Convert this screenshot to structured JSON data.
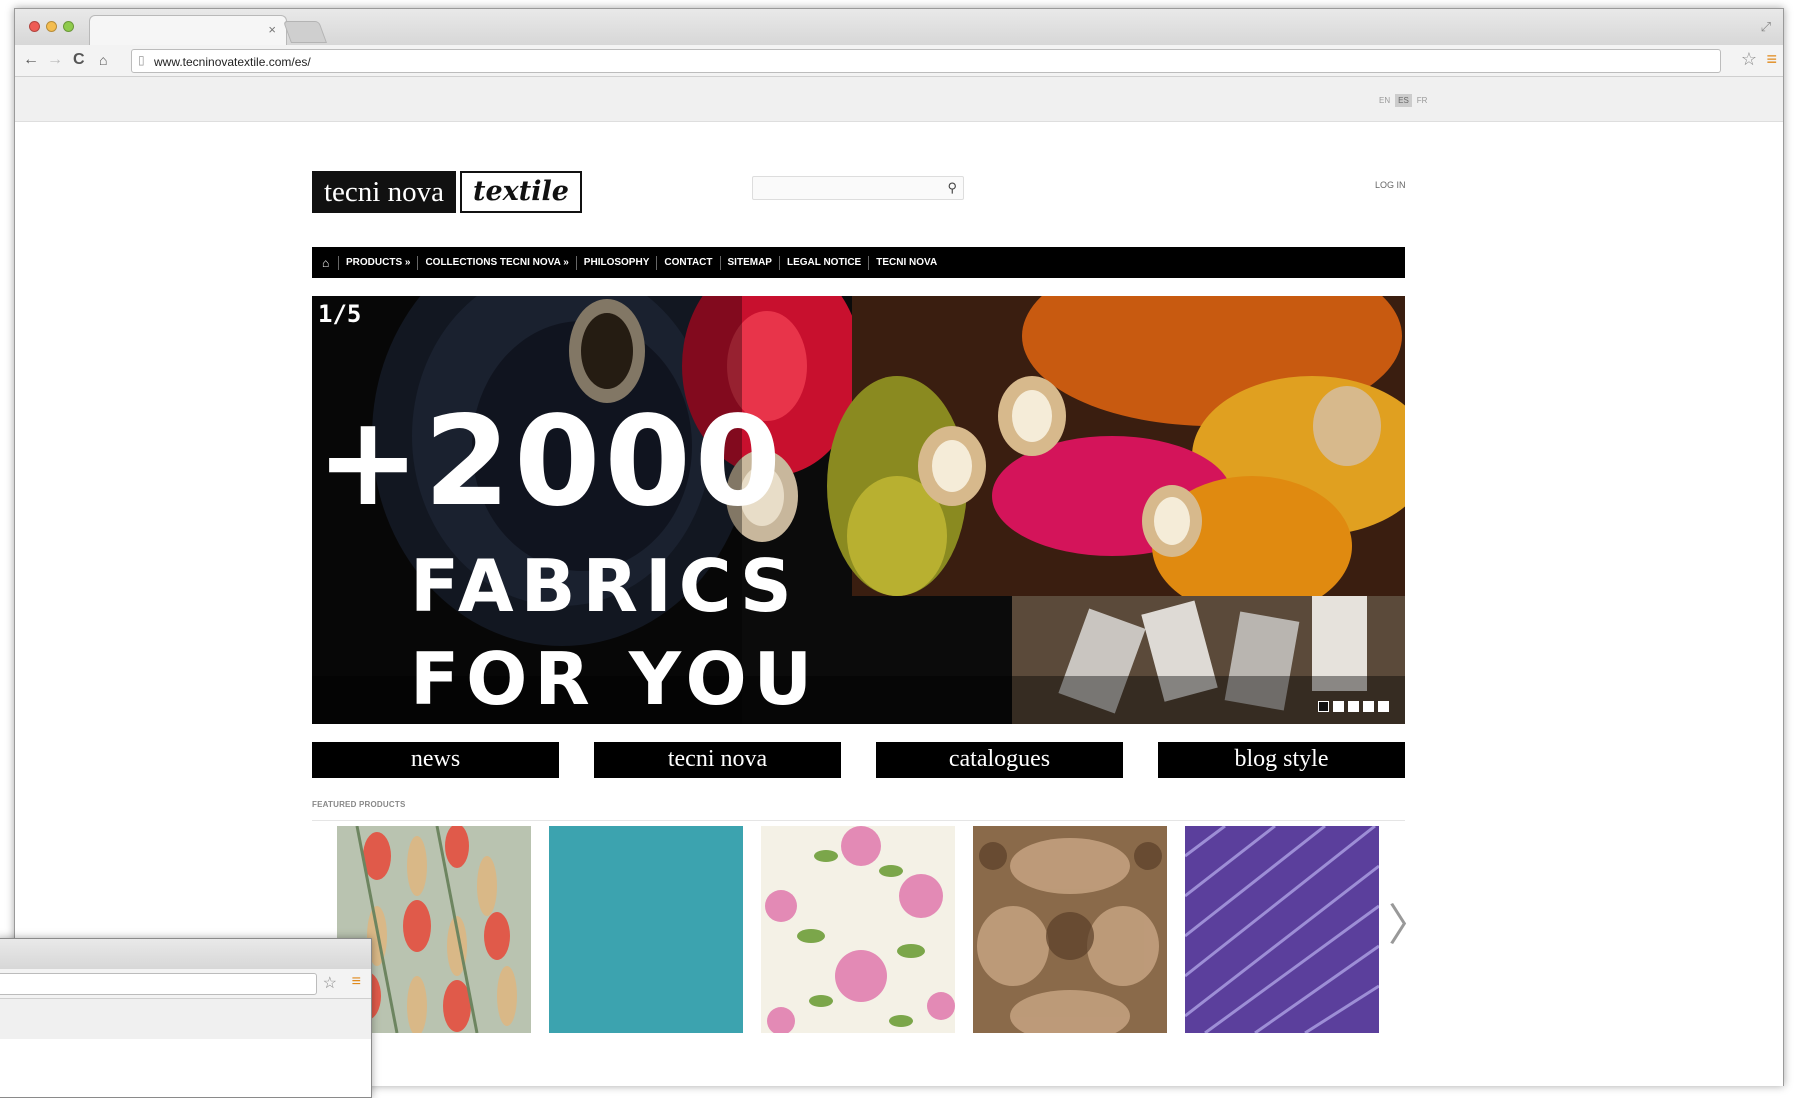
{
  "browser": {
    "url": "www.tecninovatextile.com/es/",
    "tab_close": "×",
    "resize_glyph": "⤢",
    "icons": [
      "back-arrow-icon",
      "forward-arrow-icon",
      "reload-icon",
      "home-icon",
      "star-icon",
      "menu-icon",
      "search-icon"
    ]
  },
  "languages": [
    "EN",
    "ES",
    "FR"
  ],
  "header": {
    "logo_left": "tecni nova",
    "logo_right": "textile",
    "login": "LOG IN"
  },
  "nav": {
    "items": [
      "PRODUCTS »",
      "COLLECTIONS TECNI NOVA »",
      "PHILOSOPHY",
      "CONTACT",
      "SITEMAP",
      "LEGAL NOTICE",
      "TECNI NOVA"
    ]
  },
  "hero": {
    "counter": "1/5",
    "headline": "+2000",
    "line2": "FABRICS",
    "line3": "FOR YOU",
    "slide_count": 5,
    "active_slide": 1
  },
  "buttons": [
    "news",
    "tecni nova",
    "catalogues",
    "blog style"
  ],
  "featured": {
    "label": "FEATURED PRODUCTS",
    "products": [
      "floral-red-green",
      "turquoise-plain",
      "pink-roses-white",
      "bronze-damask",
      "purple-geometric"
    ],
    "prev_arrow": "〈",
    "next_arrow": "〉"
  },
  "colors": {
    "nav_bg": "#000000",
    "turquoise": "#40aab6",
    "purple": "#5b3f9c",
    "bronze": "#8a6a4a"
  }
}
